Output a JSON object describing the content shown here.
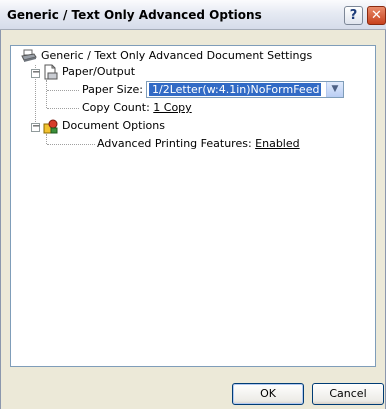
{
  "window": {
    "title": "Generic / Text Only Advanced Options",
    "help_glyph": "?",
    "close_glyph": "✕"
  },
  "tree": {
    "root_label": "Generic / Text Only Advanced Document Settings",
    "paper_output": {
      "label": "Paper/Output",
      "paper_size": {
        "label": "Paper Size:",
        "value": "1/2Letter(w:4.1in)NoFormFeed"
      },
      "copy_count": {
        "label": "Copy Count:",
        "value": "1 Copy"
      }
    },
    "document_options": {
      "label": "Document Options",
      "advanced_printing": {
        "label": "Advanced Printing Features:",
        "value": "Enabled"
      }
    }
  },
  "buttons": {
    "ok": "OK",
    "cancel": "Cancel"
  },
  "icons": {
    "expander_collapse": "minus-box",
    "dropdown": "chevron-down"
  },
  "colors": {
    "selection": "#316ac5",
    "panel_border": "#7f9db9",
    "dialog_bg": "#ece9d8"
  }
}
